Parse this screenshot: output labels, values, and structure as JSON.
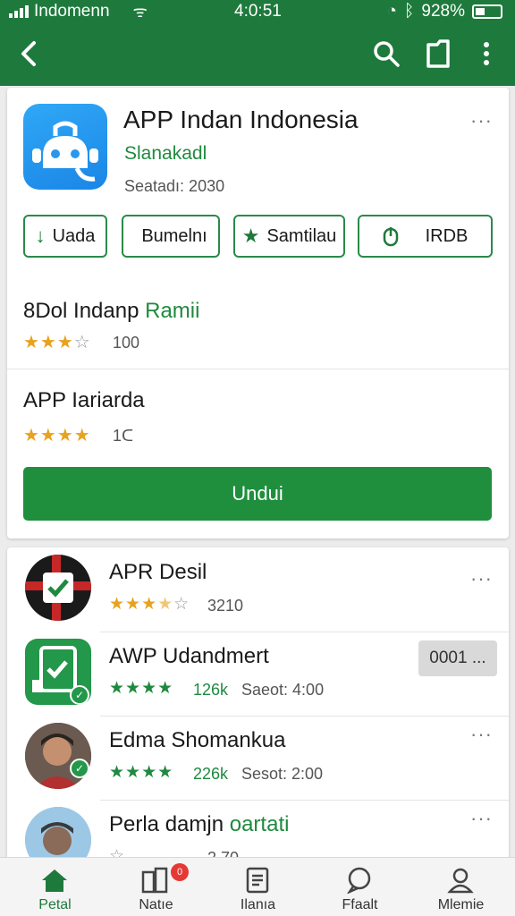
{
  "status_bar": {
    "carrier": "Indomenn",
    "time": "4:0:51",
    "battery": "928%"
  },
  "toolbar": {
    "back_icon": "arrow-left-icon",
    "search_icon": "search-icon",
    "share_icon": "share-icon",
    "menu_icon": "more-vert-icon"
  },
  "app": {
    "title": "APP Indan Indonesia",
    "developer": "Slanakadl",
    "meta": "Seatadı: 2030",
    "more": "···",
    "chips": [
      {
        "icon": "download-icon",
        "label": "Uada"
      },
      {
        "icon": "bookmark-icon",
        "label": "Bumelnı"
      },
      {
        "icon": "star-icon",
        "label": "Samtilau"
      },
      {
        "icon": "info-icon",
        "label": "IRDB"
      }
    ],
    "section1": {
      "title": "8Dol Indanp",
      "title_green": "Ramii",
      "rating": 3,
      "count": "100"
    },
    "section2": {
      "title": "APP Iariarda",
      "rating": 4,
      "count": "1ᑕ"
    },
    "download_label": "Undui"
  },
  "list": [
    {
      "name": "APR Desil",
      "name_green": "",
      "rating": 3.5,
      "star_color": "#e8a21e",
      "info": "3210",
      "extra": "",
      "pill": "",
      "more": "···"
    },
    {
      "name": "AWP Udandmert",
      "name_green": "",
      "rating": 4,
      "star_color": "#1f8a3f",
      "info": "126k",
      "extra": "Saeot: 4:00",
      "pill": "0001 ...",
      "more": ""
    },
    {
      "name": "Edma Shomankua",
      "name_green": "",
      "rating": 4,
      "star_color": "#1f8a3f",
      "info": "226k",
      "extra": "Sesot: 2:00",
      "pill": "",
      "more": "···"
    },
    {
      "name": "Perla damjn",
      "name_green": "oartati",
      "rating": 0,
      "star_color": "#999999",
      "info": "2.70",
      "extra": "",
      "pill": "",
      "more": "···"
    }
  ],
  "bottom_nav": [
    {
      "icon": "home-icon",
      "label": "Petal",
      "active": true,
      "badge": ""
    },
    {
      "icon": "library-icon",
      "label": "Natıe",
      "active": false,
      "badge": "0"
    },
    {
      "icon": "document-icon",
      "label": "Ilanıa",
      "active": false,
      "badge": ""
    },
    {
      "icon": "chat-icon",
      "label": "Ffaalt",
      "active": false,
      "badge": ""
    },
    {
      "icon": "person-icon",
      "label": "Mlemie",
      "active": false,
      "badge": ""
    }
  ],
  "colors": {
    "primary": "#1e7a3c",
    "accent": "#1f8f3e",
    "star": "#e8a21e"
  }
}
